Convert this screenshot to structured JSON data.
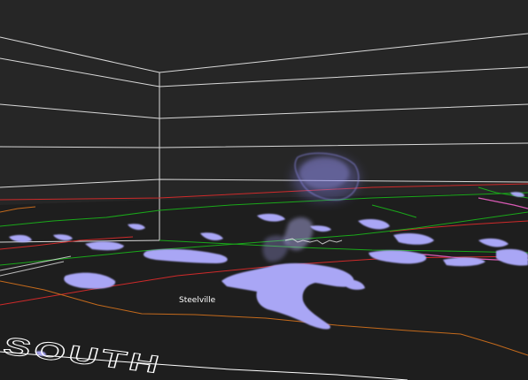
{
  "view": {
    "background_color": "#262626",
    "grid_color": "#d9d9d9",
    "ground_color": "#1e1e1e",
    "precip_color": "#a9a6f5",
    "county_line_color": "#cf2a2a",
    "highway_color": "#1aa81a",
    "river_color": "#c46a1c",
    "pink_border_color": "#d95ab4"
  },
  "labels": {
    "city": "Steelville",
    "compass": "SOUTH"
  }
}
